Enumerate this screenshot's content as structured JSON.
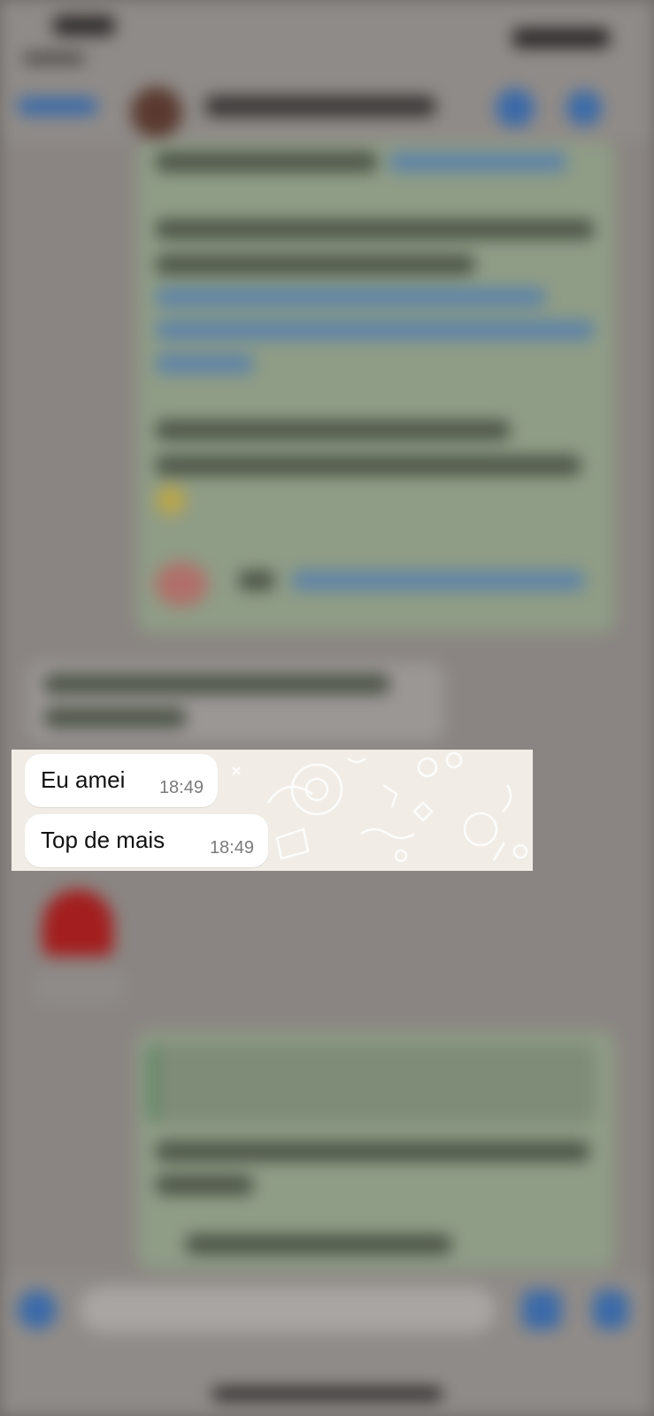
{
  "highlighted_messages": [
    {
      "text": "Eu amei",
      "time": "18:49"
    },
    {
      "text": "Top de mais",
      "time": "18:49"
    }
  ],
  "colors": {
    "wallpaper": "#f1ede6",
    "incoming_bubble": "#ffffff",
    "outgoing_bubble_blurred": "#8f9c86",
    "timestamp": "#7a7a7a",
    "overlay_dim": "#6e6a68"
  },
  "icons": [
    "back-icon",
    "video-call-icon",
    "phone-call-icon",
    "attach-plus-icon",
    "camera-icon",
    "microphone-icon",
    "heart-sticker-icon"
  ]
}
